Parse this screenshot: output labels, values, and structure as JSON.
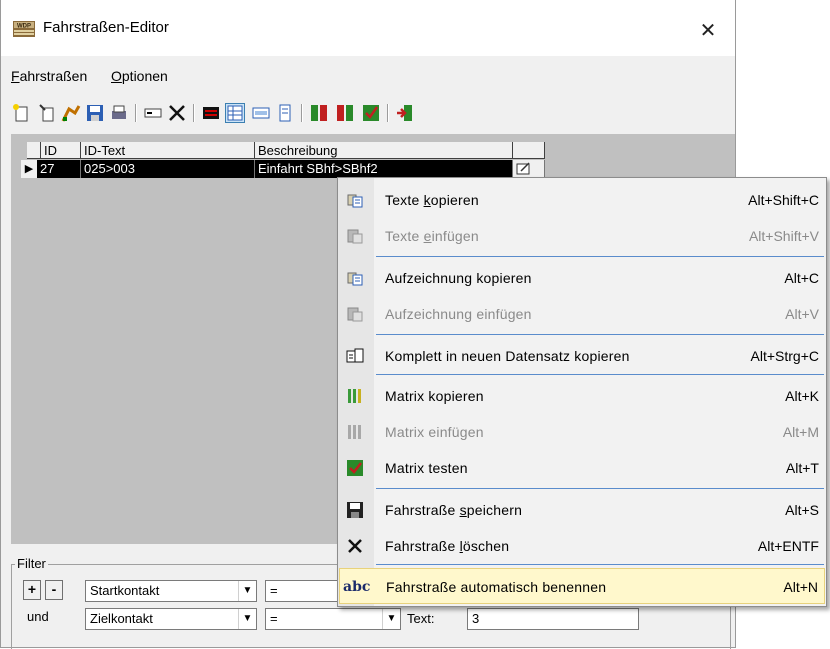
{
  "window": {
    "title": "Fahrstraßen-Editor",
    "close_glyph": "✕",
    "app_icon": "wdp-app-icon"
  },
  "menubar": [
    {
      "underline": "F",
      "rest": "ahrstraßen"
    },
    {
      "underline": "O",
      "rest": "ptionen"
    }
  ],
  "toolbar": {
    "icons": [
      "new-icon",
      "wand-icon",
      "route-icon",
      "save-icon",
      "print-icon",
      "rename-icon",
      "delete-icon",
      "matrix-icon",
      "table-view-icon",
      "form-view-icon",
      "detail-view-icon",
      "copy-matrix-icon",
      "paste-matrix-icon",
      "test-matrix-icon",
      "exit-icon"
    ]
  },
  "grid": {
    "columns": [
      "ID",
      "ID-Text",
      "Beschreibung",
      ""
    ],
    "rows": [
      {
        "id": "27",
        "id_text": "025>003",
        "beschreibung": "Einfahrt SBhf>SBhf2"
      }
    ],
    "selected_marker": "▶"
  },
  "filter": {
    "legend": "Filter",
    "plus": "+",
    "minus": "-",
    "und": "und",
    "row1": {
      "field": "Startkontakt",
      "op": "="
    },
    "row2": {
      "field": "Zielkontakt",
      "op": "=",
      "text_label": "Text:",
      "text_value": "3"
    }
  },
  "context_menu": {
    "items": [
      {
        "label_pre": "Texte ",
        "u": "k",
        "label_post": "opieren",
        "shortcut": "Alt+Shift+C",
        "enabled": true,
        "icon": "copy-icon"
      },
      {
        "label_pre": "Texte ",
        "u": "e",
        "label_post": "infügen",
        "shortcut": "Alt+Shift+V",
        "enabled": false,
        "icon": "paste-icon"
      },
      {
        "label_pre": "Aufzeichnung kopieren",
        "u": "",
        "label_post": "",
        "shortcut": "Alt+C",
        "enabled": true,
        "icon": "copy-icon"
      },
      {
        "label_pre": "Aufzeichnung einfügen",
        "u": "",
        "label_post": "",
        "shortcut": "Alt+V",
        "enabled": false,
        "icon": "paste-icon"
      },
      {
        "label_pre": "Komplett in neuen Datensatz kopieren",
        "u": "",
        "label_post": "",
        "shortcut": "Alt+Strg+C",
        "enabled": true,
        "icon": "copy-record-icon"
      },
      {
        "label_pre": "Matrix kopieren",
        "u": "",
        "label_post": "",
        "shortcut": "Alt+K",
        "enabled": true,
        "icon": "matrix-copy-icon"
      },
      {
        "label_pre": "Matrix einfügen",
        "u": "",
        "label_post": "",
        "shortcut": "Alt+M",
        "enabled": false,
        "icon": "matrix-paste-icon"
      },
      {
        "label_pre": "Matrix testen",
        "u": "",
        "label_post": "",
        "shortcut": "Alt+T",
        "enabled": true,
        "icon": "matrix-test-icon"
      },
      {
        "label_pre": "Fahrstraße ",
        "u": "s",
        "label_post": "peichern",
        "shortcut": "Alt+S",
        "enabled": true,
        "icon": "save-icon"
      },
      {
        "label_pre": "Fahrstraße ",
        "u": "l",
        "label_post": "öschen",
        "shortcut": "Alt+ENTF",
        "enabled": true,
        "icon": "delete-icon"
      },
      {
        "label_pre": "Fahrstraße automatisch benennen",
        "u": "",
        "label_post": "",
        "shortcut": "Alt+N",
        "enabled": true,
        "icon": "abc-icon",
        "highlighted": true
      }
    ],
    "abc_text": "abc",
    "highlight_color": "#fff8cc",
    "separator_color": "#5a8ccc"
  }
}
